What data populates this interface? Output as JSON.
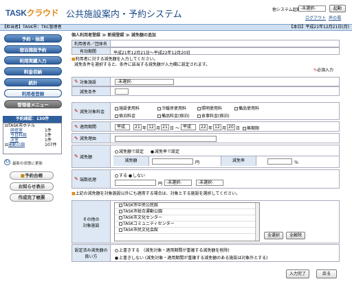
{
  "header": {
    "logo_main": "TASK",
    "logo_accent": "クラウド",
    "system_title": "公共施設案内・予約システム",
    "start_label": "他システム起動:",
    "start_select": "-未選択-",
    "start_button": "起動",
    "logout": "ログアウト",
    "help": "声の場"
  },
  "status": {
    "left": "【担当者】TASK市：TKC管理者",
    "right": "【本日】平成21年12月21日(月)"
  },
  "sidebar": {
    "menu": [
      "予約・抽選",
      "宿泊施設予約",
      "利用実績入力",
      "料金収納",
      "統計",
      "利用者登録",
      "管理者メニュー"
    ],
    "tree_header": "予約確認：130件",
    "tree": [
      [
        "TASK市ホテル",
        ""
      ],
      [
        "研修室",
        "1件"
      ],
      [
        "今日料館",
        "1件"
      ],
      [
        "洋室",
        "1件"
      ],
      [
        "運動公園",
        "107件"
      ]
    ],
    "refresh": "最新の状態に更新",
    "buttons": [
      "予約台帳",
      "お知らせ表示",
      "作成完了帳票"
    ]
  },
  "breadcrumb": "個人利用者登録 ≫ 新規登録 ≫ 減免額の追加",
  "user": {
    "name_label": "利用者名／団体名",
    "name_value": "",
    "period_label": "有効期間",
    "period_value": "平成21年12月21日～平成22年12月20日"
  },
  "notes": {
    "line1": "利用者に対する減免額を入力してください。",
    "line2": "減免条件を選択すると、条件に該当する減免額が入力欄に設定されます。",
    "required": "必須入力"
  },
  "form": {
    "facility_label": "対象施設",
    "facility_value": "-未選択-",
    "condition_label": "減免条件",
    "condition_value": "",
    "fees_label": "減免対象料金",
    "fees": [
      [
        "施設使用料",
        "冷暖房使用料",
        "照明使用料",
        "備品使用料"
      ],
      [
        "宿泊料金",
        "備品料金(宿泊)",
        "食事料金(宿泊)"
      ]
    ],
    "period_label": "適用期間",
    "era1": "平成",
    "y1": "21",
    "m1": "12",
    "d1": "21",
    "era2": "平成",
    "y2": "22",
    "m2": "12",
    "d2": "20",
    "tilde": "～",
    "unlimited": "無期限",
    "nen": "年",
    "tsuki": "月",
    "nichi": "日",
    "reason_label": "減免理由",
    "reason_value": "",
    "amount_label": "減免額",
    "amount_opt1": "減免額で設定",
    "amount_opt2": "減免率で設定",
    "amount_sub": "減免額",
    "amount_unit": "円",
    "rate_sub": "減免率",
    "rate_unit": "％",
    "round_label": "端数処理",
    "round_opt1": "する",
    "round_opt2": "しない",
    "round_unit": "円",
    "round_sel1": "-未選択-",
    "round_sel2": "-未選択-"
  },
  "other": {
    "note": "上記の減免額を対象施設以外にも適用する場合は、対象とする施設を選択してください。",
    "label_line1": "その他の",
    "label_line2": "対象施設",
    "facilities": [
      "TASK市中央公民館",
      "TASK市総合運動公園",
      "TASK市文化センター",
      "TASKコミュニティセンター",
      "TASK市民文化会館"
    ],
    "select_all": "全選択",
    "clear_all": "全解除"
  },
  "handling": {
    "label_line1": "設定済み減免額の",
    "label_line2": "扱い方",
    "opt1": "上書きする　(減免対象・適用期間が重複する減免額を削除)",
    "opt2": "上書きしない (減免対象・適用期間が重複する減免額のある施設は対象外とする)"
  },
  "actions": {
    "confirm": "入力完了",
    "back": "戻る"
  },
  "colors": {
    "brand": "#2a5599",
    "accent": "#e08a1a",
    "menu": "#2f5f9c",
    "label_bg": "#dde8f4"
  }
}
